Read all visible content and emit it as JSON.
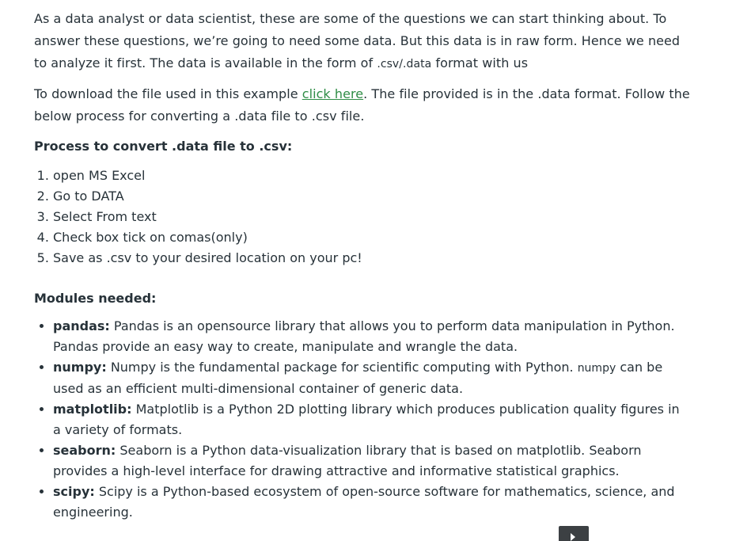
{
  "intro": {
    "text": "As a data analyst or data scientist, these are some of the questions we can start thinking about. To answer these questions, we’re going to need some data. But this data is in raw form. Hence we need to analyze it first. The data is available in the form of ",
    "code": ".csv/.data",
    "text_after": " format with us"
  },
  "download": {
    "before": "To download the file used in this example ",
    "link": "click here",
    "after": ". The file provided is in the .data format. Follow the below process for converting a .data file to .csv file."
  },
  "process": {
    "heading": "Process to convert .data file to .csv:",
    "steps": [
      "open MS Excel",
      "Go to DATA",
      "Select From text",
      "Check box tick on comas(only)",
      "Save as .csv to your desired location on your pc!"
    ]
  },
  "modules": {
    "heading": "Modules needed:",
    "items": [
      {
        "name": "pandas:",
        "desc": " Pandas is an opensource library that allows you to perform data manipulation in Python. Pandas provide an easy way to create, manipulate and wrangle the data."
      },
      {
        "name": "numpy:",
        "desc_before": " Numpy is the fundamental package for scientific computing with Python. ",
        "code": "numpy",
        "desc_after": " can be used as an efficient multi-dimensional container of generic data."
      },
      {
        "name": "matplotlib:",
        "desc": " Matplotlib is a Python 2D plotting library which produces publication quality figures in a variety of formats."
      },
      {
        "name": "seaborn:",
        "desc": " Seaborn is a Python data-visualization library that is based on matplotlib. Seaborn provides a high-level interface for drawing attractive and informative statistical graphics."
      },
      {
        "name": "scipy:",
        "desc": " Scipy is a Python-based ecosystem of open-source software for mathematics, science, and engineering."
      }
    ]
  },
  "colors": {
    "text": "#273239",
    "link": "#2f8d46",
    "scroll_button": "#3c4043"
  },
  "icons": {
    "scroll_button": "play-arrow-icon"
  }
}
